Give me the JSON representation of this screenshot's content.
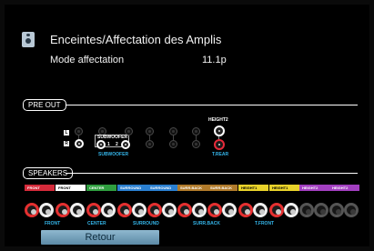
{
  "header": {
    "title": "Enceintes/Affectation des Amplis",
    "mode_label": "Mode affectation",
    "mode_value": "11.1p",
    "icon": "speaker-icon"
  },
  "pre_out": {
    "label": "PRE OUT",
    "subwoofer_box": "SUBWOOFER",
    "sub_numbers": [
      "1",
      "2"
    ],
    "subwoofer_caption": "SUBWOOFER",
    "height2_label": "HEIGHT2",
    "trear_caption": "T.REAR",
    "lr": [
      "L",
      "R"
    ]
  },
  "speakers": {
    "label": "SPEAKERS",
    "bands": [
      {
        "text": "FRONT",
        "color": "#d42a3a"
      },
      {
        "text": "FRONT",
        "color": "#ffffff"
      },
      {
        "text": "CENTER",
        "color": "#2f9e3f"
      },
      {
        "text": "SURROUND",
        "color": "#2a7fd0"
      },
      {
        "text": "SURROUND",
        "color": "#2a7fd0"
      },
      {
        "text": "SURR.BACK",
        "color": "#b07a2a"
      },
      {
        "text": "SURR.BACK",
        "color": "#b07a2a"
      },
      {
        "text": "HEIGHT1",
        "color": "#e8d22a"
      },
      {
        "text": "HEIGHT1",
        "color": "#e8d22a"
      },
      {
        "text": "HEIGHT2",
        "color": "#a23fc0"
      },
      {
        "text": "HEIGHT2",
        "color": "#a23fc0"
      }
    ],
    "captions": [
      "FRONT",
      "CENTER",
      "SURROUND",
      "SURR.BACK",
      "T.FRONT"
    ]
  },
  "back_button": "Retour"
}
